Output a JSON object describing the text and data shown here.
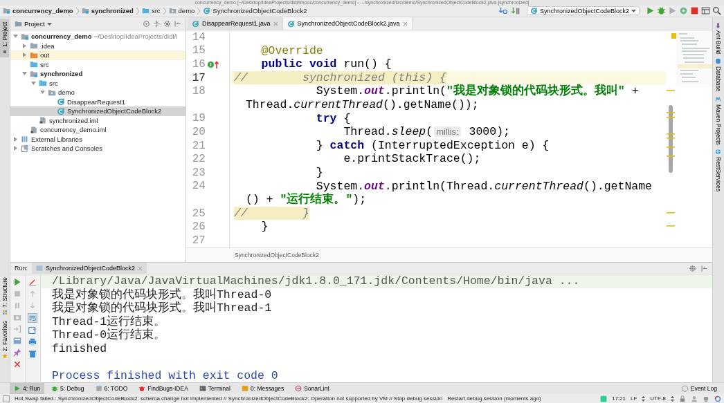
{
  "window": {
    "title": "concurrency_demo [~/Desktop/IdeaProjects/didi/imooc/concurrency_demo] - .../synchronized/src/demo/SynchronizedObjectCodeBlock2.java [synchronized]"
  },
  "navigation_bar": {
    "breadcrumbs": [
      {
        "label": "concurrency_demo",
        "kind": "module"
      },
      {
        "label": "synchronized",
        "kind": "module"
      },
      {
        "label": "src",
        "kind": "source-folder"
      },
      {
        "label": "demo",
        "kind": "package"
      },
      {
        "label": "SynchronizedObjectCodeBlock2",
        "kind": "class"
      }
    ],
    "run_configuration": "SynchronizedObjectCodeBlock2"
  },
  "left_stripe": [
    {
      "label": "1: Project",
      "kind": "project",
      "selected": true
    },
    {
      "label": "7: Structure",
      "kind": "structure",
      "selected": false
    },
    {
      "label": "2: Favorites",
      "kind": "favorites",
      "selected": false
    }
  ],
  "project_panel": {
    "title": "Project",
    "tree": [
      {
        "label": "concurrency_demo",
        "path": "~/Desktop/IdeaProjects/didi/i",
        "kind": "module",
        "expandable": true,
        "expanded": true,
        "selected": false,
        "highlighted": false,
        "children": [
          {
            "label": ".idea",
            "kind": "folder",
            "expandable": true,
            "expanded": false,
            "selected": false,
            "highlighted": false
          },
          {
            "label": "out",
            "kind": "excluded-folder",
            "expandable": true,
            "expanded": false,
            "selected": false,
            "highlighted": true
          },
          {
            "label": "src",
            "kind": "source-folder",
            "selected": false,
            "highlighted": false
          },
          {
            "label": "synchronized",
            "kind": "module",
            "expandable": true,
            "expanded": true,
            "selected": false,
            "highlighted": false,
            "children": [
              {
                "label": "src",
                "kind": "source-folder",
                "expandable": true,
                "expanded": true,
                "selected": false,
                "highlighted": false,
                "children": [
                  {
                    "label": "demo",
                    "kind": "package",
                    "expandable": true,
                    "expanded": true,
                    "selected": false,
                    "highlighted": false,
                    "children": [
                      {
                        "label": "DisappearRequest1",
                        "kind": "class",
                        "selected": false,
                        "highlighted": false
                      },
                      {
                        "label": "SynchronizedObjectCodeBlock2",
                        "kind": "class",
                        "selected": true,
                        "highlighted": false
                      }
                    ]
                  }
                ]
              },
              {
                "label": "synchronized.iml",
                "kind": "iml",
                "selected": false,
                "highlighted": false
              }
            ]
          },
          {
            "label": "concurrency_demo.iml",
            "kind": "iml",
            "selected": false,
            "highlighted": false
          }
        ]
      },
      {
        "label": "External Libraries",
        "kind": "libraries",
        "expandable": true,
        "expanded": false,
        "selected": false,
        "highlighted": false
      },
      {
        "label": "Scratches and Consoles",
        "kind": "scratches",
        "expandable": true,
        "expanded": false,
        "selected": false,
        "highlighted": false
      }
    ]
  },
  "editor": {
    "tabs": [
      {
        "label": "DisappearRequest1.java",
        "selected": false
      },
      {
        "label": "SynchronizedObjectCodeBlock2.java",
        "selected": true
      }
    ],
    "lines": [
      {
        "number": "14",
        "current": false
      },
      {
        "number": "15",
        "current": false,
        "tokens": [
          {
            "text": "    @Override",
            "kind": "annotation"
          }
        ]
      },
      {
        "number": "16",
        "current": false,
        "override_marker": true,
        "tokens": [
          {
            "text": "    public void",
            "kind": "keyword"
          },
          {
            "text": " run() {",
            "kind": "plain"
          }
        ]
      },
      {
        "number": "17",
        "current": true,
        "tokens": [
          {
            "text": "//        synchronized (this) {",
            "kind": "comment"
          }
        ]
      },
      {
        "number": "18",
        "current": false,
        "tokens": [
          {
            "text": "            System.",
            "kind": "plain"
          },
          {
            "text": "out",
            "kind": "field"
          },
          {
            "text": ".println(",
            "kind": "plain"
          },
          {
            "text": "\"我是对象锁的代码块形式。我叫\"",
            "kind": "string"
          },
          {
            "text": " +",
            "kind": "plain"
          }
        ],
        "wrapped": [
          {
            "text": "Thread.",
            "kind": "plain"
          },
          {
            "text": "currentThread",
            "kind": "static"
          },
          {
            "text": "().getName());",
            "kind": "plain"
          }
        ]
      },
      {
        "number": "19",
        "current": false,
        "tokens": [
          {
            "text": "            try",
            "kind": "keyword"
          },
          {
            "text": " {",
            "kind": "plain"
          }
        ]
      },
      {
        "number": "20",
        "current": false,
        "tokens": [
          {
            "text": "                Thread.",
            "kind": "plain"
          },
          {
            "text": "sleep",
            "kind": "static"
          },
          {
            "text": "(",
            "kind": "plain"
          },
          {
            "text": "millis:",
            "kind": "hint"
          },
          {
            "text": " 3000);",
            "kind": "plain"
          }
        ]
      },
      {
        "number": "21",
        "current": false,
        "tokens": [
          {
            "text": "            } ",
            "kind": "plain"
          },
          {
            "text": "catch",
            "kind": "keyword"
          },
          {
            "text": " (InterruptedException e) {",
            "kind": "plain"
          }
        ]
      },
      {
        "number": "22",
        "current": false,
        "tokens": [
          {
            "text": "                e.printStackTrace();",
            "kind": "plain"
          }
        ]
      },
      {
        "number": "23",
        "current": false,
        "tokens": [
          {
            "text": "            }",
            "kind": "plain"
          }
        ]
      },
      {
        "number": "24",
        "current": false,
        "tokens": [
          {
            "text": "            System.",
            "kind": "plain"
          },
          {
            "text": "out",
            "kind": "field"
          },
          {
            "text": ".println(Thread.",
            "kind": "plain"
          },
          {
            "text": "currentThread",
            "kind": "static"
          },
          {
            "text": "().getName",
            "kind": "plain"
          }
        ],
        "wrapped": [
          {
            "text": "() + ",
            "kind": "plain"
          },
          {
            "text": "\"运行结束。\"",
            "kind": "string"
          },
          {
            "text": ");",
            "kind": "plain"
          }
        ]
      },
      {
        "number": "25",
        "current": false,
        "tokens": [
          {
            "text": "//        }",
            "kind": "comment"
          }
        ]
      },
      {
        "number": "26",
        "current": false,
        "tokens": [
          {
            "text": "    }",
            "kind": "plain"
          }
        ]
      },
      {
        "number": "27",
        "current": false
      }
    ],
    "breadcrumb": "SynchronizedObjectCodeBlock2"
  },
  "right_stripe": [
    {
      "label": "Ant Build",
      "kind": "ant"
    },
    {
      "label": "Database",
      "kind": "database"
    },
    {
      "label": "Maven Projects",
      "kind": "maven"
    },
    {
      "label": "RestServices",
      "kind": "rest"
    }
  ],
  "run_panel": {
    "label": "Run:",
    "tab": "SynchronizedObjectCodeBlock2",
    "output": [
      {
        "text": "/Library/Java/JavaVirtualMachines/jdk1.8.0_171.jdk/Contents/Home/bin/java ...",
        "kind": "command"
      },
      {
        "text": "我是对象锁的代码块形式。我叫Thread-0",
        "kind": "stdout"
      },
      {
        "text": "我是对象锁的代码块形式。我叫Thread-1",
        "kind": "stdout"
      },
      {
        "text": "Thread-1运行结束。",
        "kind": "stdout"
      },
      {
        "text": "Thread-0运行结束。",
        "kind": "stdout"
      },
      {
        "text": "finished",
        "kind": "stdout"
      },
      {
        "text": "Process finished with exit code 0",
        "kind": "exit"
      }
    ]
  },
  "tool_windows": [
    {
      "label": "4: Run",
      "kind": "run",
      "selected": true
    },
    {
      "label": "5: Debug",
      "kind": "debug",
      "selected": false
    },
    {
      "label": "6: TODO",
      "kind": "todo",
      "selected": false
    },
    {
      "label": "FindBugs-IDEA",
      "kind": "findbugs",
      "selected": false
    },
    {
      "label": "Terminal",
      "kind": "terminal",
      "selected": false
    },
    {
      "label": "0: Messages",
      "kind": "messages",
      "selected": false
    },
    {
      "label": "SonarLint",
      "kind": "sonarlint",
      "selected": false
    }
  ],
  "event_log": "Event Log",
  "status_bar": {
    "message": "Hot Swap failed.: SynchronizedObjectCodeBlock2: schema change not implemented // SynchronizedObjectCodeBlock2: Operation not supported by VM // Stop debug session",
    "secondary": "Restart debug session (moments ago)",
    "time": "17:21",
    "line_separator": "LF",
    "encoding": "UTF-8"
  }
}
